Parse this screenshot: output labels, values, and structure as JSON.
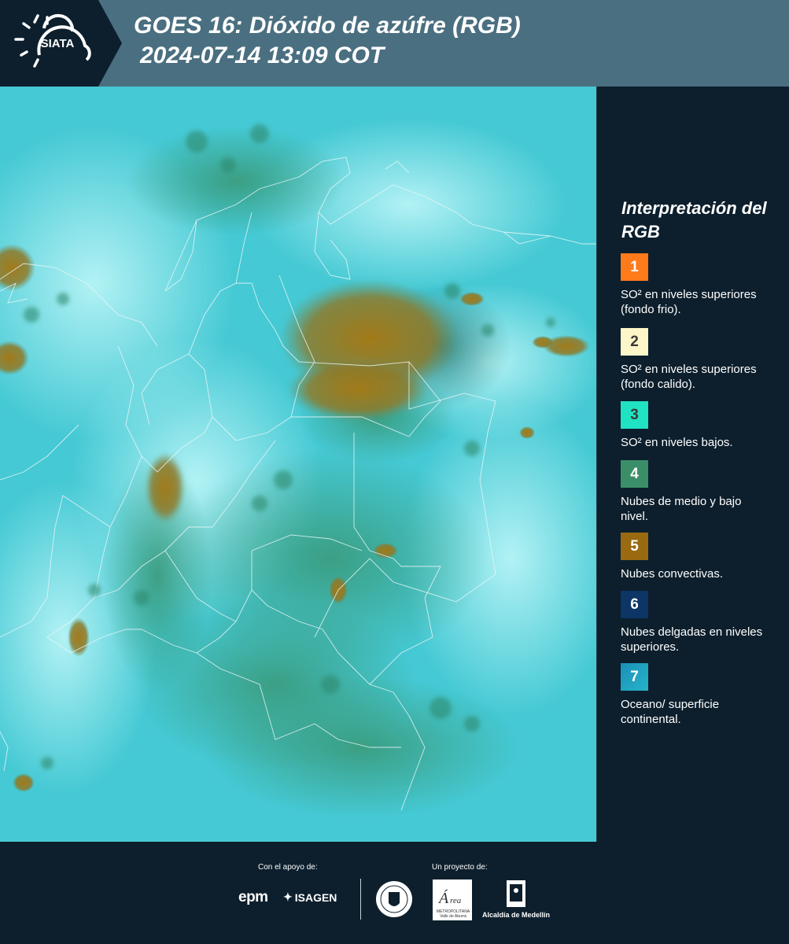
{
  "header": {
    "logo_text": "SIATA",
    "title_line1": "GOES 16: Dióxido de azúfre (RGB)",
    "title_line2": "2024-07-14 13:09 COT"
  },
  "legend": {
    "title": "Interpretación del RGB",
    "items": [
      {
        "number": "1",
        "color": "#ff7a1a",
        "text": "SO² en niveles superiores (fondo frio)."
      },
      {
        "number": "2",
        "color": "#fdf6c8",
        "text": "SO² en niveles superiores (fondo calido)."
      },
      {
        "number": "3",
        "color": "#1fe3c2",
        "text": "SO² en niveles bajos."
      },
      {
        "number": "4",
        "color": "#3a8f68",
        "text": "Nubes de medio y bajo nivel."
      },
      {
        "number": "5",
        "color": "#9a6a10",
        "text": "Nubes convectivas."
      },
      {
        "number": "6",
        "color": "#0d3566",
        "text": "Nubes delgadas en niveles superiores."
      },
      {
        "number": "7",
        "color": "#1a8fb8",
        "text": "Oceano/ superficie continental."
      }
    ]
  },
  "footer": {
    "support_label": "Con el apoyo de:",
    "project_label": "Un proyecto de:",
    "epm": "epm",
    "isagen": "ISAGEN",
    "area_text": "METROPOLITANA Valle de Aburrá",
    "alcaldia": "Alcaldía de Medellín"
  }
}
